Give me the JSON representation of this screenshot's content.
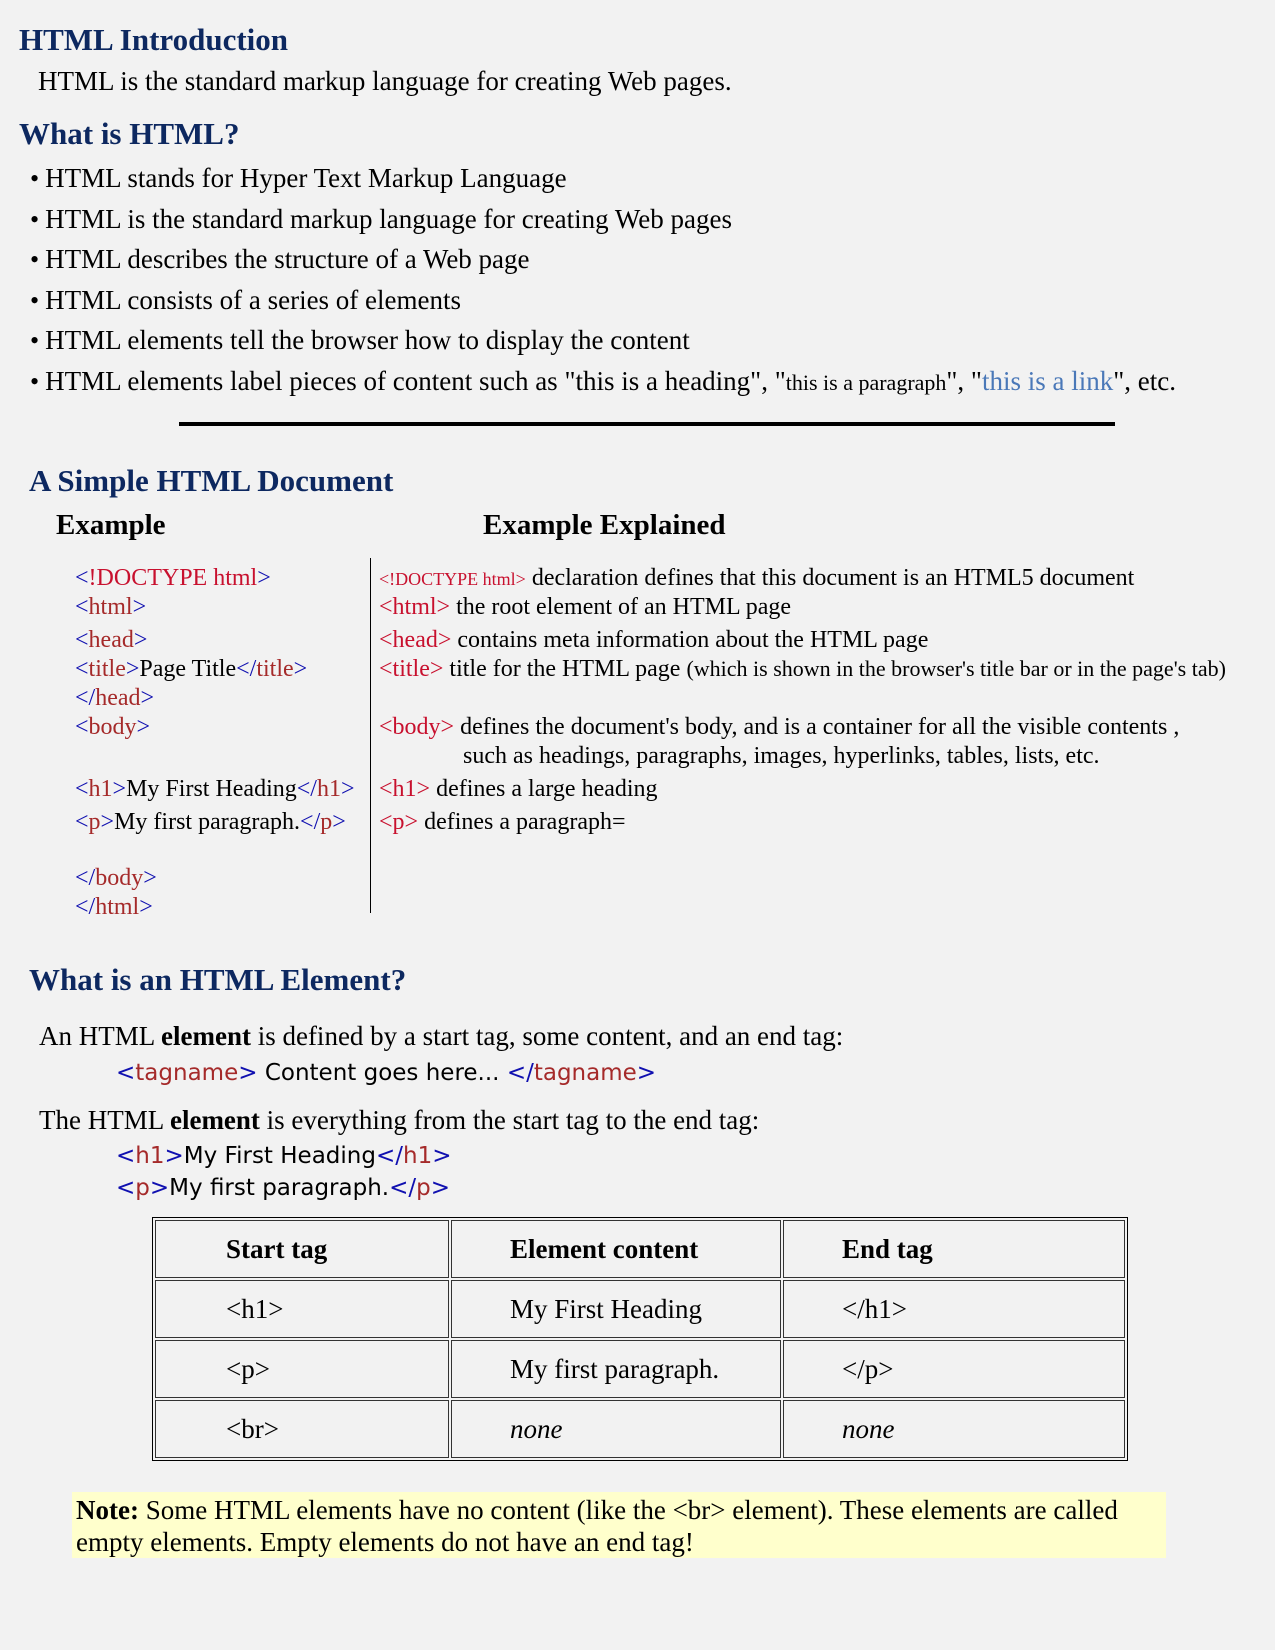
{
  "intro": {
    "title": "HTML Introduction",
    "text": "HTML is the standard markup language for creating Web pages."
  },
  "what": {
    "title": "What is HTML?",
    "bullets": [
      [
        {
          "t": "HTML stands for Hyper Text Markup Language",
          "c": "k"
        }
      ],
      [
        {
          "t": "HTML is the standard markup language for creating Web pages",
          "c": "k"
        }
      ],
      [
        {
          "t": "HTML describes the structure of a Web page",
          "c": "k"
        }
      ],
      [
        {
          "t": "HTML consists of a series of elements",
          "c": "k"
        }
      ],
      [
        {
          "t": "HTML elements tell the browser how to display the content",
          "c": "k"
        }
      ],
      [
        {
          "t": "HTML elements label pieces of content such as \"this is a heading\", \"",
          "c": "k"
        },
        {
          "t": "this is a paragraph",
          "c": "k sm2"
        },
        {
          "t": "\", \"",
          "c": "k"
        },
        {
          "t": "this is a link",
          "c": "lk"
        },
        {
          "t": "\", etc.",
          "c": "k"
        }
      ]
    ]
  },
  "simple": {
    "title": "A Simple HTML Document",
    "example_label": "Example",
    "explained_label": "Example Explained",
    "code": [
      [
        {
          "t": "<",
          "c": "b"
        },
        {
          "t": "!DOCTYPE html",
          "c": "d"
        },
        {
          "t": ">",
          "c": "b"
        }
      ],
      [
        {
          "t": "<",
          "c": "b"
        },
        {
          "t": "html",
          "c": "r"
        },
        {
          "t": ">",
          "c": "b"
        }
      ],
      [
        {
          "t": "<",
          "c": "b"
        },
        {
          "t": "head",
          "c": "r"
        },
        {
          "t": ">",
          "c": "b"
        }
      ],
      [
        {
          "t": "<",
          "c": "b"
        },
        {
          "t": "title",
          "c": "r"
        },
        {
          "t": ">",
          "c": "b"
        },
        {
          "t": "Page Title",
          "c": "k"
        },
        {
          "t": "</",
          "c": "b"
        },
        {
          "t": "title",
          "c": "r"
        },
        {
          "t": ">",
          "c": "b"
        }
      ],
      [
        {
          "t": "</",
          "c": "b"
        },
        {
          "t": "head",
          "c": "r"
        },
        {
          "t": ">",
          "c": "b"
        }
      ],
      [
        {
          "t": "<",
          "c": "b"
        },
        {
          "t": "body",
          "c": "r"
        },
        {
          "t": ">",
          "c": "b"
        }
      ],
      [
        {
          "t": "<",
          "c": "b"
        },
        {
          "t": "h1",
          "c": "r"
        },
        {
          "t": ">",
          "c": "b"
        },
        {
          "t": "My First Heading",
          "c": "k"
        },
        {
          "t": "</",
          "c": "b"
        },
        {
          "t": "h1",
          "c": "r"
        },
        {
          "t": ">",
          "c": "b"
        }
      ],
      [
        {
          "t": "<",
          "c": "b"
        },
        {
          "t": "p",
          "c": "r"
        },
        {
          "t": ">",
          "c": "b"
        },
        {
          "t": "My first paragraph.",
          "c": "k"
        },
        {
          "t": "</",
          "c": "b"
        },
        {
          "t": "p",
          "c": "r"
        },
        {
          "t": ">",
          "c": "b"
        }
      ],
      [
        {
          "t": "</",
          "c": "b"
        },
        {
          "t": "body",
          "c": "r"
        },
        {
          "t": ">",
          "c": "b"
        }
      ],
      [
        {
          "t": "</",
          "c": "b"
        },
        {
          "t": "html",
          "c": "r"
        },
        {
          "t": ">",
          "c": "b"
        }
      ]
    ],
    "explained": [
      [
        {
          "t": "<!DOCTYPE html>",
          "c": "d sm"
        },
        {
          "t": " declaration defines that this document is an HTML5 document",
          "c": "k"
        }
      ],
      [
        {
          "t": "<html>",
          "c": "d"
        },
        {
          "t": " the root element of an HTML page",
          "c": "k"
        }
      ],
      [
        {
          "t": " <head>",
          "c": "d"
        },
        {
          "t": " contains meta information about the HTML page",
          "c": "k"
        }
      ],
      [
        {
          "t": "<title>",
          "c": "d"
        },
        {
          "t": " title for the HTML page ",
          "c": "k"
        },
        {
          "t": "(which is shown in the browser's title bar or in the page's tab)",
          "c": "k sm2"
        }
      ],
      [
        {
          "t": "<body>",
          "c": "d"
        },
        {
          "t": " defines the document's body, and is a container for all the visible contents ,",
          "c": "k"
        }
      ],
      [
        {
          "t": "such as headings, paragraphs, images, hyperlinks, tables, lists, etc.",
          "c": "k"
        }
      ],
      [
        {
          "t": "<h1>",
          "c": "d"
        },
        {
          "t": "  defines a large heading",
          "c": "k"
        }
      ],
      [
        {
          "t": " <p>",
          "c": "d"
        },
        {
          "t": " defines a paragraph=",
          "c": "k"
        }
      ]
    ]
  },
  "element": {
    "title": "What is an HTML Element?",
    "line1": [
      {
        "t": "An HTML ",
        "c": "k"
      },
      {
        "t": "element",
        "c": "k bold"
      },
      {
        "t": " is defined by a start tag, some content, and an end tag:",
        "c": "k"
      }
    ],
    "syntax": [
      {
        "t": "<",
        "c": "b"
      },
      {
        "t": "tagname",
        "c": "r"
      },
      {
        "t": ">",
        "c": "b"
      },
      {
        "t": " Content goes here... ",
        "c": "k"
      },
      {
        "t": "</",
        "c": "b"
      },
      {
        "t": "tagname",
        "c": "r"
      },
      {
        "t": ">",
        "c": "b"
      }
    ],
    "line2": [
      {
        "t": "The HTML ",
        "c": "k"
      },
      {
        "t": "element",
        "c": "k bold"
      },
      {
        "t": " is everything from the start tag to the end tag:",
        "c": "k"
      }
    ],
    "ex1": [
      {
        "t": "<",
        "c": "b"
      },
      {
        "t": "h1",
        "c": "r"
      },
      {
        "t": ">",
        "c": "b"
      },
      {
        "t": "My First Heading",
        "c": "k"
      },
      {
        "t": "</",
        "c": "b"
      },
      {
        "t": "h1",
        "c": "r"
      },
      {
        "t": ">",
        "c": "b"
      }
    ],
    "ex2": [
      {
        "t": "<",
        "c": "b"
      },
      {
        "t": "p",
        "c": "r"
      },
      {
        "t": ">",
        "c": "b"
      },
      {
        "t": "My first paragraph.",
        "c": "k"
      },
      {
        "t": "</",
        "c": "b"
      },
      {
        "t": "p",
        "c": "r"
      },
      {
        "t": ">",
        "c": "b"
      }
    ]
  },
  "table": {
    "headers": [
      "Start tag",
      "Element content",
      "End tag"
    ],
    "rows": [
      [
        "<h1>",
        "My First Heading",
        "</h1>"
      ],
      [
        "<p>",
        "My first paragraph.",
        "</p>"
      ],
      [
        "<br>",
        "none",
        "none"
      ]
    ]
  },
  "note": {
    "label": "Note:",
    "text": " Some HTML elements have no content (like the <br> element). These elements are called empty elements. Empty elements do not have an end tag!"
  },
  "colors": {
    "heading": "#0d2860",
    "tag_bracket": "#1010b0",
    "tag_name": "#a52a2a",
    "link": "#4a78b8",
    "note_bg": "#ffffcc",
    "background": "#f2f2f2"
  }
}
